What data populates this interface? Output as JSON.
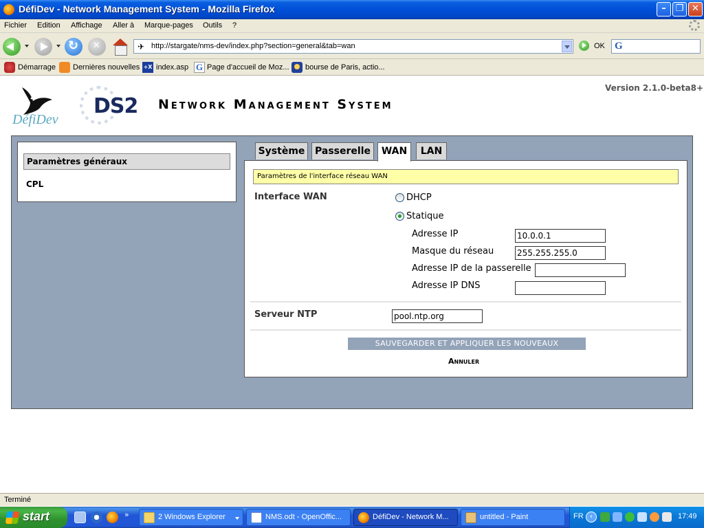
{
  "window": {
    "title": "DéfiDev - Network Management System - Mozilla Firefox",
    "min_glyph": "–",
    "max_glyph": "❐",
    "close_glyph": "✕"
  },
  "menu": [
    "Fichier",
    "Edition",
    "Affichage",
    "Aller à",
    "Marque-pages",
    "Outils",
    "?"
  ],
  "navigation": {
    "url": "http://stargate/nms-dev/index.php?section=general&tab=wan",
    "go_label": "OK",
    "site_icon": "✈",
    "search_icon_text": "G"
  },
  "bookmarks": [
    {
      "label": "Démarrage",
      "icon": "red-bookmark-icon"
    },
    {
      "label": "Dernières nouvelles",
      "icon": "rss-feed-icon"
    },
    {
      "label": "index.asp",
      "icon": "tx-site-icon",
      "icon_text": "+X"
    },
    {
      "label": "Page d'accueil de Moz...",
      "icon": "google-icon",
      "icon_text": "G"
    },
    {
      "label": "bourse de Paris, actio...",
      "icon": "finance-site-icon"
    }
  ],
  "header": {
    "version": "Version 2.1.0-beta8+",
    "logo_brand": "DéfiDev",
    "logo_product": "DS2",
    "page_title": "Network Management System"
  },
  "sidebar": {
    "items": [
      {
        "label": "Paramètres généraux",
        "active": true
      },
      {
        "label": "CPL",
        "active": false
      }
    ]
  },
  "tabs": [
    {
      "label": "Système",
      "active": false
    },
    {
      "label": "Passerelle",
      "active": false
    },
    {
      "label": "WAN",
      "active": true
    },
    {
      "label": "LAN",
      "active": false
    }
  ],
  "form": {
    "info": "Paramètres de l'interface réseau WAN",
    "interface_label": "Interface WAN",
    "mode_options": [
      {
        "label": "DHCP",
        "checked": false
      },
      {
        "label": "Statique",
        "checked": true
      }
    ],
    "fields": {
      "ip": {
        "label": "Adresse IP",
        "value": "10.0.0.1"
      },
      "mask": {
        "label": "Masque du réseau",
        "value": "255.255.255.0"
      },
      "gateway": {
        "label": "Adresse IP de la passerelle",
        "value": ""
      },
      "dns": {
        "label": "Adresse IP DNS",
        "value": ""
      }
    },
    "ntp_label": "Serveur NTP",
    "ntp_value": "pool.ntp.org",
    "save_label": "SAUVEGARDER ET APPLIQUER LES NOUVEAUX PARAMÈTRES",
    "cancel_label": "Annuler"
  },
  "status": "Terminé",
  "taskbar": {
    "start_label": "start",
    "more_glyph": "»",
    "tasks": [
      {
        "label": "2 Windows Explorer",
        "active": false
      },
      {
        "label": "NMS.odt - OpenOffic...",
        "active": false
      },
      {
        "label": "DéfiDev - Network M...",
        "active": true
      },
      {
        "label": "untitled - Paint",
        "active": false
      }
    ],
    "lang": "FR",
    "tray_chevron": "‹",
    "clock": "17:49"
  },
  "colors": {
    "panel_bg": "#93a3b8",
    "info_bg": "#ffffa8",
    "taskbar_blue": "#2157d7",
    "start_green": "#2e912e"
  }
}
